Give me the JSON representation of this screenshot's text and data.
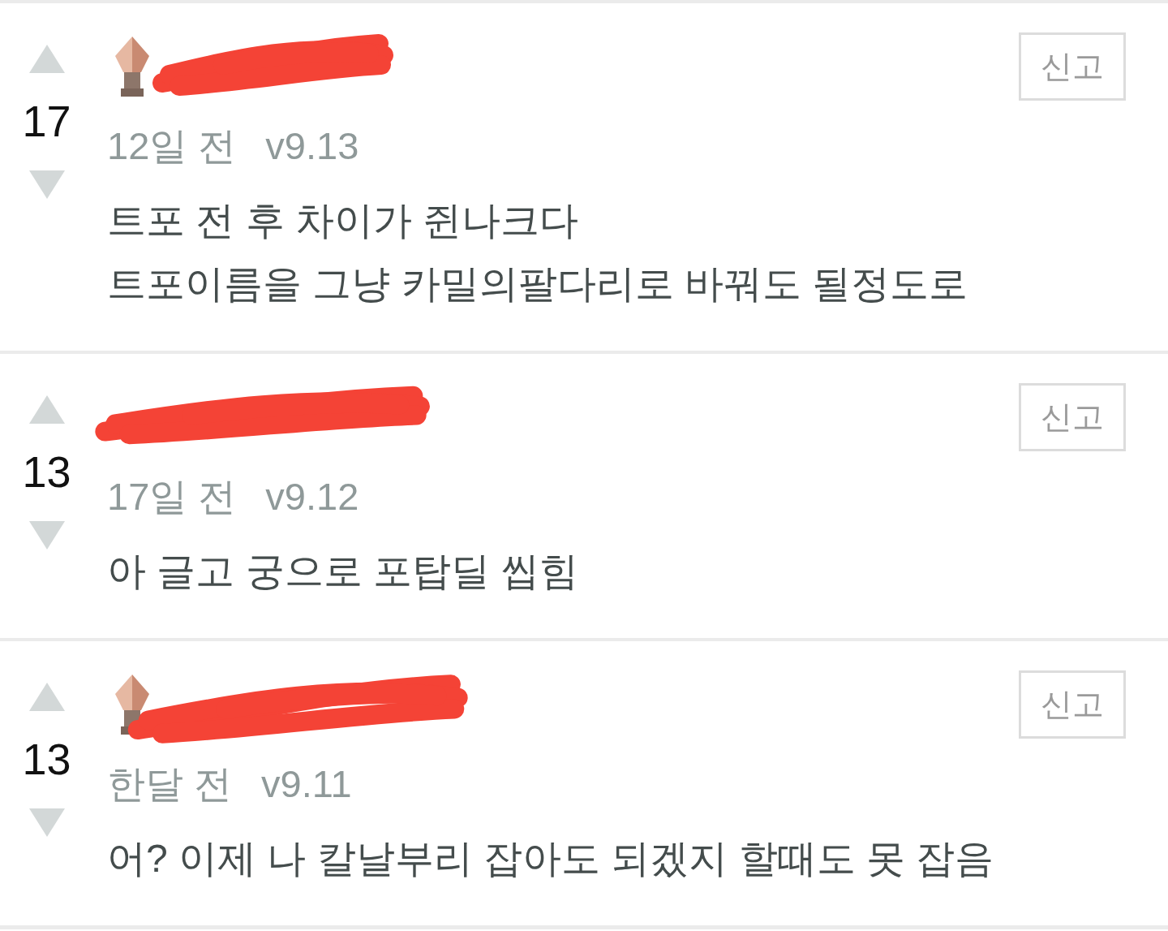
{
  "comments": [
    {
      "votes": "17",
      "author": {
        "avatar": true,
        "redacted": true
      },
      "time": "12일 전",
      "version": "v9.13",
      "text": "트포 전 후 차이가 쥔나크다\n트포이름을 그냥 카밀의팔다리로 바꿔도 될정도로",
      "report_label": "신고"
    },
    {
      "votes": "13",
      "author": {
        "avatar": false,
        "redacted": true
      },
      "time": "17일 전",
      "version": "v9.12",
      "text": "아 글고 궁으로 포탑딜 씹힘",
      "report_label": "신고"
    },
    {
      "votes": "13",
      "author": {
        "avatar": true,
        "redacted": true
      },
      "time": "한달 전",
      "version": "v9.11",
      "text": "어? 이제 나 칼날부리 잡아도 되겠지 할때도 못 잡음",
      "report_label": "신고"
    }
  ]
}
